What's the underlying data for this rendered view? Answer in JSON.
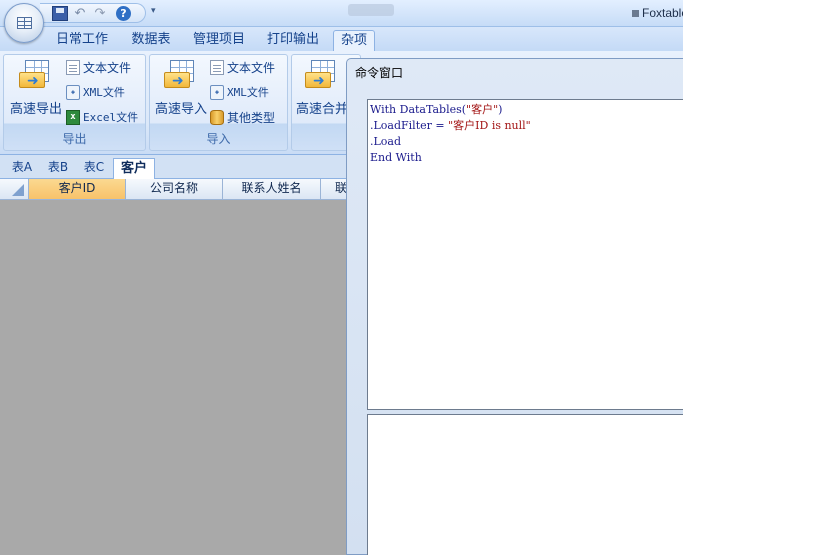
{
  "titlebar": {
    "app_title": "Foxtable"
  },
  "ribbon_tabs": [
    "日常工作",
    "数据表",
    "管理项目",
    "打印输出",
    "杂项"
  ],
  "ribbon": {
    "export_group": {
      "label": "导出",
      "big_button": "高速导出",
      "small_buttons": [
        "文本文件",
        "XML文件",
        "Excel文件"
      ]
    },
    "import_group": {
      "label": "导入",
      "big_button": "高速导入",
      "small_buttons": [
        "文本文件",
        "XML文件",
        "其他类型"
      ]
    },
    "merge_group": {
      "big_button": "高速合并"
    }
  },
  "sheet_tabs": [
    "表A",
    "表B",
    "表C",
    "客户"
  ],
  "grid": {
    "columns": [
      "客户ID",
      "公司名称",
      "联系人姓名",
      "联"
    ]
  },
  "command_window": {
    "title": "命令窗口",
    "code": {
      "l1_pre": "With DataTables(",
      "l1_str": "\"客户\"",
      "l1_post": ")",
      "l2_pre": ".LoadFilter = ",
      "l2_str": "\"客户ID is null\"",
      "l3": ".Load",
      "l4": "End With"
    }
  },
  "colors": {
    "ribbon_bg": "#bfdbff",
    "selected_header": "#f8c26a",
    "grid_empty": "#a9a9a9",
    "code_keyword": "#1a1a8c",
    "code_string": "#a31515"
  }
}
